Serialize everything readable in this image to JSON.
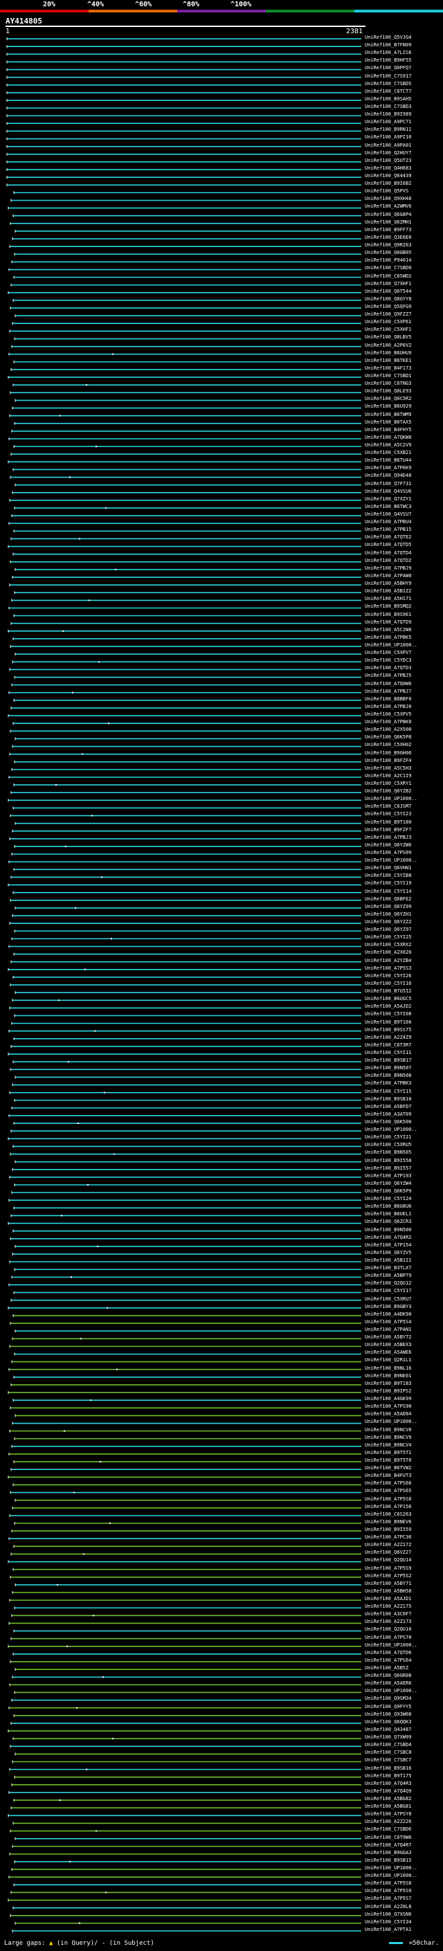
{
  "scale": {
    "segments": [
      {
        "color": "#d40000"
      },
      {
        "color": "#e06600"
      },
      {
        "color": "#7a1fa0"
      },
      {
        "color": "#0a8a2a"
      },
      {
        "color": "#1ec8d8"
      }
    ],
    "labels": [
      "20%",
      "^40%",
      "^60%",
      "^80%",
      "^100%"
    ]
  },
  "query": {
    "name": "AY414805",
    "start": "1",
    "end": "2381"
  },
  "colors": {
    "cyan": "#2bd6e3",
    "green": "#6fbf2a",
    "white": "#ffffff",
    "yellow": "#ffdd00"
  },
  "footer": {
    "gaps_prefix": "Large gaps:",
    "in_query": "(in Query)/",
    "in_subject": "- (in Subject)",
    "legend": "=50char."
  },
  "hits": [
    "UniRef100_Q5VJG4",
    "UniRef100_B7FN09",
    "UniRef100_A7LIS6",
    "UniRef100_B9HF55",
    "UniRef100_Q0PFQ7",
    "UniRef100_C7S917",
    "UniRef100_C7SBD5",
    "UniRef100_C6TCT7",
    "UniRef100_B9SAH5",
    "UniRef100_C7SBD3",
    "UniRef100_B9I989",
    "UniRef100_A9PC71",
    "UniRef100_B9RN11",
    "UniRef100_A9PI10",
    "UniRef100_A9PA01",
    "UniRef100_Q2HUY7",
    "UniRef100_Q5UT23",
    "UniRef100_Q4H683",
    "UniRef100_Q64439",
    "UniRef100_B9I6B2",
    "UniRef100_Q5PVS",
    "UniRef100_Q9XH48",
    "UniRef100_A2WMV6",
    "UniRef100_Q6G8P4",
    "UniRef100_Q6ZMH1",
    "UniRef100_B9FF73",
    "UniRef100_Q3E6E0",
    "UniRef100_Q9R263",
    "UniRef100_Q0GB05",
    "UniRef100_P94014",
    "UniRef100_C7SBD0",
    "UniRef100_C6SWD2",
    "UniRef100_Q7XHF1",
    "UniRef100_Q6T544",
    "UniRef100_Q8GYY8",
    "UniRef100_Q5QFG9",
    "UniRef100_Q9FZZ7",
    "UniRef100_C5XP61",
    "UniRef100_C5XHF1",
    "UniRef100_Q8LBV5",
    "UniRef100_A2P6V2",
    "UniRef100_B6UHU9",
    "UniRef100_B6TKE1",
    "UniRef100_B4F173",
    "UniRef100_C7SBD1",
    "UniRef100_C6TNG3",
    "UniRef100_Q8LE93",
    "UniRef100_Q6C5R2",
    "UniRef100_B6U929",
    "UniRef100_B6TWM9",
    "UniRef100_B6TAX5",
    "UniRef100_B4FHY5",
    "UniRef100_A7QKW8",
    "UniRef100_A5C2V9",
    "UniRef100_C5XB21",
    "UniRef100_B6TU44",
    "UniRef100_A7P6K9",
    "UniRef100_Q94D48",
    "UniRef100_Q7F731",
    "UniRef100_Q4VSU6",
    "UniRef100_Q7XZY1",
    "UniRef100_B6TWC3",
    "UniRef100_Q4VSU7",
    "UniRef100_A7PBU4",
    "UniRef100_A7PB15",
    "UniRef100_A7QTE2",
    "UniRef100_A7QTD5",
    "UniRef100_A7QTD4",
    "UniRef100_A7QTD2",
    "UniRef100_A7PBJ9",
    "UniRef100_A7PAW0",
    "UniRef100_A5BHY9",
    "UniRef100_A5B1Z2",
    "UniRef100_A5H171",
    "UniRef100_B9SMQ2",
    "UniRef100_B9S961",
    "UniRef100_A7QTD9",
    "UniRef100_A5C2W8",
    "UniRef100_A7PBK5",
    "UniRef100_UP1000..",
    "UniRef100_C5XPV7",
    "UniRef100_C5YDC3",
    "UniRef100_A7QTD3",
    "UniRef100_A7PBJ5",
    "UniRef100_A7Q0W6",
    "UniRef100_A7PBJ7",
    "UniRef100_B8BBF0",
    "UniRef100_A7PBJ0",
    "UniRef100_C5XPV5",
    "UniRef100_A7PBK0",
    "UniRef100_A2X500",
    "UniRef100_Q6K5P8",
    "UniRef100_C5XH02",
    "UniRef100_B9GH06",
    "UniRef100_B9FZF4",
    "UniRef100_A5C5H3",
    "UniRef100_A2C1I9",
    "UniRef100_C5XRY1",
    "UniRef100_Q6YZB2",
    "UniRef100_UP1000..",
    "UniRef100_C6JSM7",
    "UniRef100_C5YI23",
    "UniRef100_B9T180",
    "UniRef100_B9FZF7",
    "UniRef100_A7PBJ3",
    "UniRef100_Q6YZW6",
    "UniRef100_A7PS09",
    "UniRef100_UP1000..",
    "UniRef100_Q6VHN1",
    "UniRef100_C5YIB8",
    "UniRef100_C5YI19",
    "UniRef100_C5YI14",
    "UniRef100_Q6BFE2",
    "UniRef100_Q6YZ99",
    "UniRef100_Q6YZH1",
    "UniRef100_Q6YZZ2",
    "UniRef100_Q6YZ97",
    "UniRef100_C5YI25",
    "UniRef100_C5XRX2",
    "UniRef100_A2X020",
    "UniRef100_A2YZB4",
    "UniRef100_A7P5S3",
    "UniRef100_C5YI26",
    "UniRef100_C5YI16",
    "UniRef100_B7U5I2",
    "UniRef100_B6UGC5",
    "UniRef100_A5AJD2",
    "UniRef100_C5YI08",
    "UniRef100_B9T166",
    "UniRef100_B9SS75",
    "UniRef100_A2Z4Z9",
    "UniRef100_C6T3R7",
    "UniRef100_C5YI11",
    "UniRef100_B9SB17",
    "UniRef100_B9N507",
    "UniRef100_B9N508",
    "UniRef100_A7PBK3",
    "UniRef100_C5YI15",
    "UniRef100_B9SB18",
    "UniRef100_A5BFD7",
    "UniRef100_A3AT09",
    "UniRef100_Q6K500",
    "UniRef100_UP1000..",
    "UniRef100_C5YI21",
    "UniRef100_C5XRU5",
    "UniRef100_B9N505",
    "UniRef100_B9I558",
    "UniRef100_B9I557",
    "UniRef100_A7P193",
    "UniRef100_Q6YZW4",
    "UniRef100_Q6K5P9",
    "UniRef100_C5YI24",
    "UniRef100_B6U8U6",
    "UniRef100_B6UEL1",
    "UniRef100_Q6ZCR3",
    "UniRef100_B9N500",
    "UniRef100_A7Q4R2",
    "UniRef100_A7P154",
    "UniRef100_Q6YZV5",
    "UniRef100_A5B1I1",
    "UniRef100_B3TLX7",
    "UniRef100_A5BP79",
    "UniRef100_Q2QU12",
    "UniRef100_C5YI17",
    "UniRef100_C5XRU7",
    "UniRef100_B9GBY3",
    "UniRef100_A4DK90",
    "UniRef100_A7P5S4",
    "UniRef100_A7PAN1",
    "UniRef100_A5BY72",
    "UniRef100_A5BEX3",
    "UniRef100_A5AWE6",
    "UniRef100_Q2R1L1",
    "UniRef100_B9NL16",
    "UniRef100_B9NE01",
    "UniRef100_B9T183",
    "UniRef100_B9IPS2",
    "UniRef100_A4GK99",
    "UniRef100_A7PS90",
    "UniRef100_A5AD84",
    "UniRef100_UP1000..",
    "UniRef100_B9NCV8",
    "UniRef100_B9NCV9",
    "UniRef100_B9NCV4",
    "UniRef100_B9T5T1",
    "UniRef100_B9T5T0",
    "UniRef100_B6TVW2",
    "UniRef100_B4FUT3",
    "UniRef100_A7PS66",
    "UniRef100_A7PS65",
    "UniRef100_A7P5S8",
    "UniRef100_A7P156",
    "UniRef100_C6S263",
    "UniRef100_B9NEV6",
    "UniRef100_B9I559",
    "UniRef100_A7PC36",
    "UniRef100_A2Z172",
    "UniRef100_Q6VZ27",
    "UniRef100_Q2QU14",
    "UniRef100_A7P5S9",
    "UniRef100_A7P5S2",
    "UniRef100_A5BY71",
    "UniRef100_A5BH58",
    "UniRef100_A5AJD1",
    "UniRef100_A2Z175",
    "UniRef100_A3C0F7",
    "UniRef100_A2Z173",
    "UniRef100_Q2QU10",
    "UniRef100_A7PS70",
    "UniRef100_UP1000..",
    "UniRef100_A7QTD6",
    "UniRef100_A7PS64",
    "UniRef100_A5B5Z",
    "UniRef100_Q6GR08",
    "UniRef100_A5AER6",
    "UniRef100_UP1000..",
    "UniRef100_Q9SM34",
    "UniRef100_Q9FYY5",
    "UniRef100_Q93W08",
    "UniRef100_Q6QQK3",
    "UniRef100_Q43487",
    "UniRef100_Q7XW99",
    "UniRef100_C7SBD4",
    "UniRef100_C7SBC8",
    "UniRef100_C7SBC7",
    "UniRef100_B9SB16",
    "UniRef100_B9T175",
    "UniRef100_A7Q4R3",
    "UniRef100_A7Q4Q9",
    "UniRef100_A5BG82",
    "UniRef100_A5BG81",
    "UniRef100_A7PSY8",
    "UniRef100_A2Z226",
    "UniRef100_C7SBD6",
    "UniRef100_C6T9W6",
    "UniRef100_A7Q4R7",
    "UniRef100_B9GGA3",
    "UniRef100_B9SB15",
    "UniRef100_UP1000..",
    "UniRef100_UP1000..",
    "UniRef100_A7P5S8",
    "UniRef100_A7P5S9",
    "UniRef100_A7P5S7",
    "UniRef100_A2Z0L8",
    "UniRef100_Q7XSN6",
    "UniRef100_C5YI34",
    "UniRef100_A7PTA1"
  ]
}
